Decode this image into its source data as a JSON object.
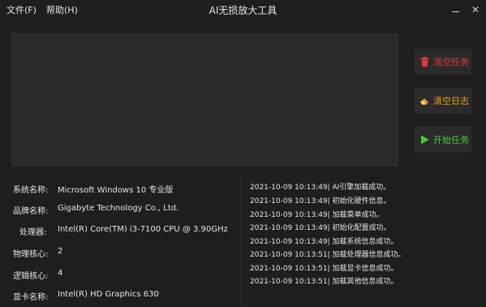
{
  "menu": {
    "file": "文件(F)",
    "help": "帮助(H)"
  },
  "window": {
    "title": "AI无损放大工具",
    "minimize": "—",
    "close": "✕"
  },
  "actions": [
    {
      "label": "清空任务",
      "icon": "trash-icon",
      "color": "#e23a3a"
    },
    {
      "label": "清空日志",
      "icon": "eraser-icon",
      "color": "#e89a1c"
    },
    {
      "label": "开始任务",
      "icon": "play-icon",
      "color": "#49c63b"
    }
  ],
  "system_info": [
    {
      "label": "系统名称:",
      "value": "Microsoft Windows 10 专业版"
    },
    {
      "label": "品牌名称:",
      "value": "Gigabyte Technology Co., Ltd."
    },
    {
      "label": "处理器:",
      "value": "Intel(R) Core(TM) i3-7100 CPU @ 3.90GHz"
    },
    {
      "label": "物理核心:",
      "value": "2"
    },
    {
      "label": "逻辑核心:",
      "value": "4"
    },
    {
      "label": "显卡名称:",
      "value": "Intel(R) HD Graphics 630"
    }
  ],
  "log": [
    "2021-10-09 10:13:49| AI引擎加载成功。",
    "2021-10-09 10:13:49| 初始化硬件信息。",
    "2021-10-09 10:13:49| 加载菜单成功。",
    "2021-10-09 10:13:49| 初始化配置成功。",
    "2021-10-09 10:13:49| 加载系统信息成功。",
    "2021-10-09 10:13:51| 加载处理器信息成功。",
    "2021-10-09 10:13:51| 加载显卡信息成功。",
    "2021-10-09 10:13:51| 加载其他信息成功。"
  ]
}
